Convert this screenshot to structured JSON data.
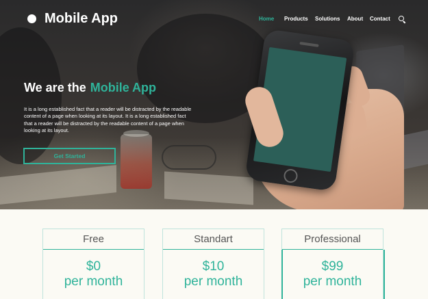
{
  "brand": {
    "name": "Mobile App"
  },
  "nav": {
    "items": [
      {
        "label": "Home",
        "active": true
      },
      {
        "label": "Products",
        "active": false
      },
      {
        "label": "Solutions",
        "active": false
      },
      {
        "label": "About",
        "active": false
      },
      {
        "label": "Contact",
        "active": false
      }
    ],
    "search_icon": "search-icon"
  },
  "hero": {
    "title_prefix": "We are the",
    "title_accent": "Mobile App",
    "text": "It is a long established fact that a reader will be distracted by the readable content of a page when looking at its layout. It is a long established fact that a reader will be distracted by the readable content of a page when looking at its layout.",
    "cta_label": "Get Started"
  },
  "pricing": {
    "plans": [
      {
        "name": "Free",
        "price": "$0",
        "period": "per month",
        "featured": false
      },
      {
        "name": "Standart",
        "price": "$10",
        "period": "per month",
        "featured": false
      },
      {
        "name": "Professional",
        "price": "$99",
        "period": "per month",
        "featured": true
      }
    ]
  },
  "colors": {
    "accent": "#2fb39a",
    "hero_bg": "#2f2d2b",
    "page_bg": "#fbfaf4",
    "phone_screen": "#2c5f58"
  }
}
